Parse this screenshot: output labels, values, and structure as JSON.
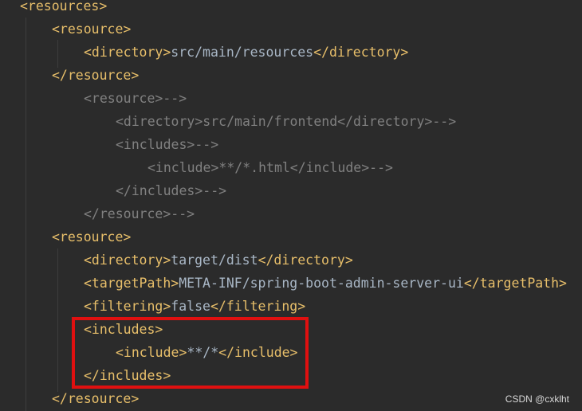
{
  "editor": {
    "lines": [
      {
        "indent": 0,
        "kind": "tag",
        "text": "<resources>"
      },
      {
        "indent": 1,
        "kind": "tag",
        "text": "<resource>"
      },
      {
        "indent": 2,
        "kind": "mixed",
        "open": "<directory>",
        "value": "src/main/resources",
        "close": "</directory>"
      },
      {
        "indent": 1,
        "kind": "tag",
        "text": "</resource>"
      },
      {
        "indent": 2,
        "kind": "comment",
        "text": "<resource>-->"
      },
      {
        "indent": 3,
        "kind": "comment",
        "text": "<directory>src/main/frontend</directory>-->"
      },
      {
        "indent": 3,
        "kind": "comment",
        "text": "<includes>-->"
      },
      {
        "indent": 4,
        "kind": "comment",
        "text": "<include>**/*.html</include>-->"
      },
      {
        "indent": 3,
        "kind": "comment",
        "text": "</includes>-->"
      },
      {
        "indent": 2,
        "kind": "comment",
        "text": "</resource>-->"
      },
      {
        "indent": 1,
        "kind": "tag",
        "text": "<resource>"
      },
      {
        "indent": 2,
        "kind": "mixed",
        "open": "<directory>",
        "value": "target/dist",
        "close": "</directory>"
      },
      {
        "indent": 2,
        "kind": "mixed",
        "open": "<targetPath>",
        "value": "META-INF/spring-boot-admin-server-ui",
        "close": "</targetPath>"
      },
      {
        "indent": 2,
        "kind": "mixed",
        "open": "<filtering>",
        "value": "false",
        "close": "</filtering>"
      },
      {
        "indent": 2,
        "kind": "tag",
        "text": "<includes>"
      },
      {
        "indent": 3,
        "kind": "mixed",
        "open": "<include>",
        "value": "**/*",
        "close": "</include>"
      },
      {
        "indent": 2,
        "kind": "tag",
        "text": "</includes>"
      },
      {
        "indent": 1,
        "kind": "tag",
        "text": "</resource>"
      }
    ]
  },
  "colors": {
    "background": "#2b2b2b",
    "tag": "#e8bf6a",
    "text": "#a9b7c6",
    "comment": "#808080",
    "highlight_border": "#e01010"
  },
  "watermark": "CSDN @cxklht"
}
